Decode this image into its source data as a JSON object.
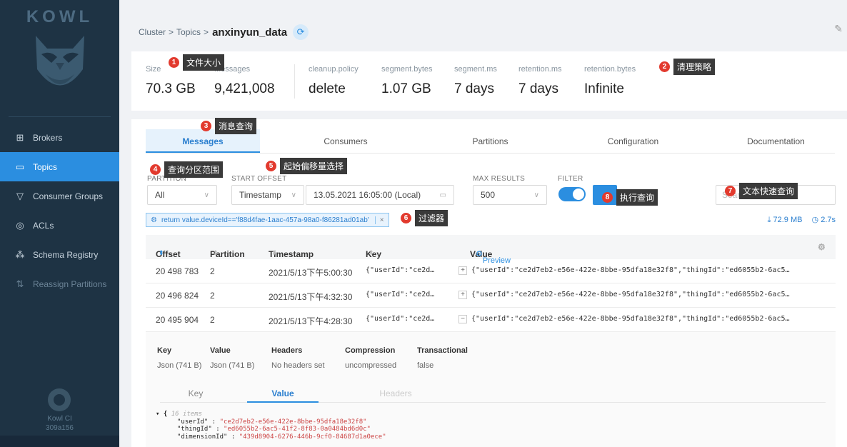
{
  "sidebar": {
    "logo": "KOWL",
    "items": [
      {
        "icon": "server-icon",
        "glyph": "⊞",
        "label": "Brokers"
      },
      {
        "icon": "folder-icon",
        "glyph": "▭",
        "label": "Topics"
      },
      {
        "icon": "filter-icon",
        "glyph": "▽",
        "label": "Consumer Groups"
      },
      {
        "icon": "shield-icon",
        "glyph": "◎",
        "label": "ACLs"
      },
      {
        "icon": "schema-icon",
        "glyph": "⁂",
        "label": "Schema Registry"
      },
      {
        "icon": "reassign-icon",
        "glyph": "⇅",
        "label": "Reassign Partitions"
      }
    ],
    "footer_name": "Kowl CI",
    "footer_version": "309a156"
  },
  "breadcrumb": {
    "cluster": "Cluster",
    "sep1": ">",
    "topics": "Topics",
    "sep2": ">",
    "current": "anxinyun_data"
  },
  "stats": [
    {
      "label": "Size",
      "value": "70.3 GB"
    },
    {
      "label": "Messages",
      "value": "9,421,008"
    },
    {
      "label": "cleanup.policy",
      "value": "delete"
    },
    {
      "label": "segment.bytes",
      "value": "1.07 GB"
    },
    {
      "label": "segment.ms",
      "value": "7 days"
    },
    {
      "label": "retention.ms",
      "value": "7 days"
    },
    {
      "label": "retention.bytes",
      "value": "Infinite"
    }
  ],
  "tabs": [
    "Messages",
    "Consumers",
    "Partitions",
    "Configuration",
    "Documentation"
  ],
  "controls": {
    "partition_label": "PARTITION",
    "partition_value": "All",
    "start_offset_label": "START OFFSET",
    "start_offset_mode": "Timestamp",
    "start_offset_time": "13.05.2021 16:05:00 (Local)",
    "max_results_label": "MAX RESULTS",
    "max_results_value": "500",
    "filter_label": "FILTER",
    "search_placeholder": "Search"
  },
  "filter_tag": "return value.deviceId=='f88d4fae-1aac-457a-98a0-f86281ad01ab'",
  "meta": {
    "size": "72.9 MB",
    "time": "2.7s"
  },
  "table": {
    "headers": [
      "Offset",
      "Partition",
      "Timestamp",
      "Key",
      "Value"
    ],
    "preview_label": "Preview",
    "rows": [
      {
        "offset": "20 498 783",
        "partition": "2",
        "timestamp": "2021/5/13下午5:00:30",
        "key": "{\"userId\":\"ce2d…",
        "toggle": "+",
        "value": "{\"userId\":\"ce2d7eb2-e56e-422e-8bbe-95dfa18e32f8\",\"thingId\":\"ed6055b2-6ac5…"
      },
      {
        "offset": "20 496 824",
        "partition": "2",
        "timestamp": "2021/5/13下午4:32:30",
        "key": "{\"userId\":\"ce2d…",
        "toggle": "+",
        "value": "{\"userId\":\"ce2d7eb2-e56e-422e-8bbe-95dfa18e32f8\",\"thingId\":\"ed6055b2-6ac5…"
      },
      {
        "offset": "20 495 904",
        "partition": "2",
        "timestamp": "2021/5/13下午4:28:30",
        "key": "{\"userId\":\"ce2d…",
        "toggle": "−",
        "value": "{\"userId\":\"ce2d7eb2-e56e-422e-8bbe-95dfa18e32f8\",\"thingId\":\"ed6055b2-6ac5…"
      }
    ]
  },
  "detail": {
    "cols": [
      {
        "h": "Key",
        "v": "Json (741 B)"
      },
      {
        "h": "Value",
        "v": "Json (741 B)"
      },
      {
        "h": "Headers",
        "v": "No headers set"
      },
      {
        "h": "Compression",
        "v": "uncompressed"
      },
      {
        "h": "Transactional",
        "v": "false"
      }
    ],
    "tabs": [
      "Key",
      "Value",
      "Headers"
    ],
    "json_count": "16 items",
    "json_lines": [
      {
        "k": "\"userId\"",
        "v": "\"ce2d7eb2-e56e-422e-8bbe-95dfa18e32f8\""
      },
      {
        "k": "\"thingId\"",
        "v": "\"ed6055b2-6ac5-41f2-8f83-0a0484bd6d0c\""
      },
      {
        "k": "\"dimensionId\"",
        "v": "\"439d8904-6276-446b-9cf0-84687d1a0ece\""
      }
    ]
  },
  "annotations": [
    {
      "n": "1",
      "t": "文件大小"
    },
    {
      "n": "2",
      "t": "清理策略"
    },
    {
      "n": "3",
      "t": "消息查询"
    },
    {
      "n": "4",
      "t": "查询分区范围"
    },
    {
      "n": "5",
      "t": "起始偏移量选择"
    },
    {
      "n": "6",
      "t": "过滤器"
    },
    {
      "n": "7",
      "t": "文本快速查询"
    },
    {
      "n": "8",
      "t": "执行查询"
    }
  ]
}
